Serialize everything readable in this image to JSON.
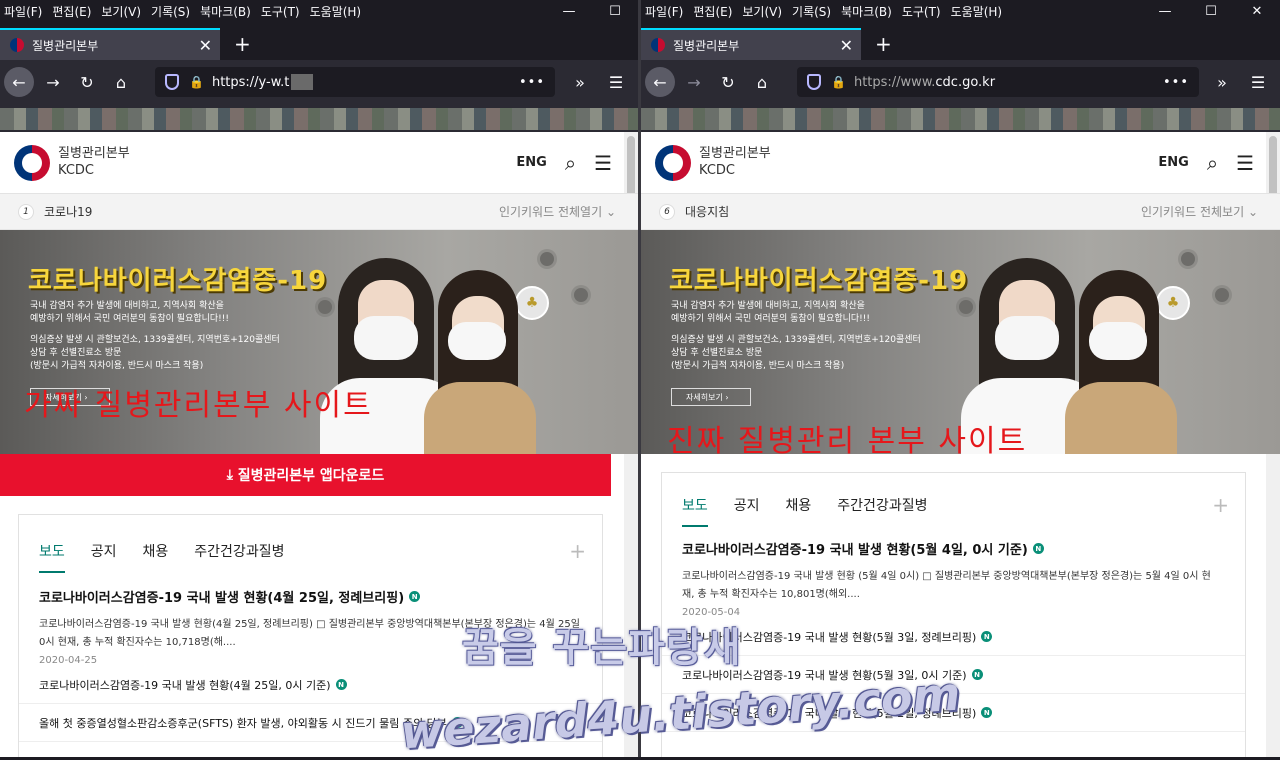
{
  "menu": [
    "파일(F)",
    "편집(E)",
    "보기(V)",
    "기록(S)",
    "북마크(B)",
    "도구(T)",
    "도움말(H)"
  ],
  "window_controls": {
    "min": "—",
    "max": "☐",
    "close": "✕"
  },
  "left": {
    "tab_title": "질병관리본부",
    "url": "https://y-w.t",
    "site": {
      "brand_ko": "질병관리본부",
      "brand_en": "KCDC",
      "eng": "ENG",
      "keyword_num": "1",
      "keyword": "코로나19",
      "keyword_all": "인기키워드 전체열기"
    },
    "overlay": "가짜 질병관리본부 사이트",
    "download_button": "질병관리본부 앱다운로드",
    "news": {
      "headline": "코로나바이러스감염증-19 국내 발생 현황(4월 25일, 정례브리핑)",
      "summary": "코로나바이러스감염증-19 국내 발생 현황(4월 25일, 정례브리핑) □ 질병관리본부 중앙방역대책본부(본부장 정은경)는 4월 25일 0시 현재, 총 누적 확진자수는 10,718명(해....",
      "date": "2020-04-25",
      "items": [
        "코로나바이러스감염증-19 국내 발생 현황(4월 25일, 0시 기준)",
        "올해 첫 중증열성혈소판감소증후군(SFTS) 환자 발생, 야외활동 시 진드기 물림 주의 당부"
      ]
    }
  },
  "right": {
    "tab_title": "질병관리본부",
    "url_prefix": "https://www.",
    "url_domain": "cdc.go.kr",
    "site": {
      "brand_ko": "질병관리본부",
      "brand_en": "KCDC",
      "eng": "ENG",
      "keyword_num": "6",
      "keyword": "대응지침",
      "keyword_all": "인기키워드 전체보기"
    },
    "overlay": "진짜 질병관리 본부 사이트",
    "news": {
      "headline": "코로나바이러스감염증-19 국내 발생 현황(5월 4일, 0시 기준)",
      "summary": "코로나바이러스감염증-19 국내 발생 현황 (5월 4일 0시) □ 질병관리본부 중앙방역대책본부(본부장 정은경)는 5월 4일 0시 현재, 총 누적 확진자수는 10,801명(해외....",
      "date": "2020-05-04",
      "items": [
        "코로나바이러스감염증-19 국내 발생 현황(5월 3일, 정례브리핑)",
        "코로나바이러스감염증-19 국내 발생 현황(5월 3일, 0시 기준)",
        "코로나바이러스감염증-19 국내 발생 현황(5월 2일, 정례브리핑)"
      ]
    }
  },
  "banner": {
    "title": "코로나바이러스감염증-19",
    "desc1": "국내 감염자 추가 발생에 대비하고, 지역사회 확산을",
    "desc2": "예방하기 위해서 국민 여러분의 동참이 필요합니다!!!",
    "desc3": "의심증상 발생 시 관할보건소, 1339콜센터, 지역번호+120콜센터",
    "desc4": "상담 후 선별진료소 방문",
    "desc5": "(방문시 가급적 자차이용, 반드시 마스크 착용)",
    "button": "자세히보기"
  },
  "news_tabs": [
    "보도",
    "공지",
    "채용",
    "주간건강과질병"
  ],
  "new_badge": "N",
  "watermark_ko": "꿈을 꾸는파랑새",
  "watermark_en": "wezard4u.tistory.com",
  "colors": {
    "accent_green": "#007a6e",
    "download_red": "#e8112d",
    "overlay_red": "#e5171b",
    "banner_title": "#f7d63c"
  }
}
